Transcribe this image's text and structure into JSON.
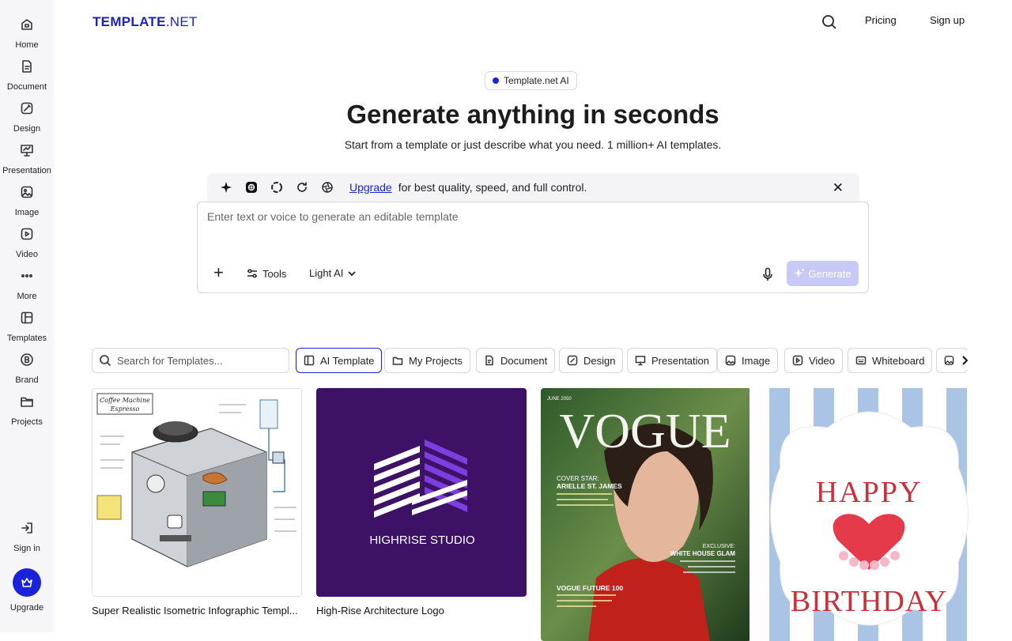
{
  "sidebar": {
    "items": [
      {
        "label": "Home",
        "icon": "home-icon"
      },
      {
        "label": "Document",
        "icon": "document-icon"
      },
      {
        "label": "Design",
        "icon": "design-icon"
      },
      {
        "label": "Presentation",
        "icon": "presentation-icon"
      },
      {
        "label": "Image",
        "icon": "image-icon"
      },
      {
        "label": "Video",
        "icon": "video-icon"
      },
      {
        "label": "More",
        "icon": "more-icon"
      },
      {
        "label": "Templates",
        "icon": "templates-icon"
      },
      {
        "label": "Brand",
        "icon": "brand-icon"
      },
      {
        "label": "Projects",
        "icon": "folder-icon"
      }
    ],
    "signin_label": "Sign in",
    "upgrade_label": "Upgrade"
  },
  "header": {
    "logo_main": "TEMPLATE",
    "logo_suffix": ".NET",
    "pricing_label": "Pricing",
    "signup_label": "Sign up"
  },
  "hero": {
    "badge": "Template.net AI",
    "title": "Generate anything in seconds",
    "subtitle": "Start from a template or just describe what you need. 1 million+ AI templates."
  },
  "upgrade_bar": {
    "link_label": "Upgrade",
    "text": "for best quality, speed, and full control."
  },
  "prompt": {
    "placeholder": "Enter text or voice to generate an editable template",
    "tools_label": "Tools",
    "model_label": "Light AI",
    "generate_label": "Generate"
  },
  "filters": {
    "search_placeholder": "Search for Templates...",
    "chips": [
      "AI Template",
      "My Projects",
      "Document",
      "Design",
      "Presentation",
      "Image",
      "Video",
      "Whiteboard"
    ]
  },
  "cards": [
    {
      "title": "Super Realistic Isometric Infographic Templ...",
      "art_title": "Coffee Machine",
      "art_subtitle": "Espresso"
    },
    {
      "title": "High-Rise Architecture Logo",
      "art_text": "HIGHRISE STUDIO"
    },
    {
      "title": "",
      "masthead": "VOGUE",
      "issue": "JUNE 2050",
      "cover_star_label": "COVER STAR:",
      "cover_star_name": "ARIELLE ST. JAMES",
      "exclusive_label": "EXCLUSIVE:",
      "exclusive_title": "WHITE HOUSE GLAM",
      "future_label": "VOGUE FUTURE 100"
    },
    {
      "title": "",
      "line1": "HAPPY",
      "line2": "BIRTHDAY"
    }
  ],
  "colors": {
    "brand": "#1a23d9",
    "generate_disabled": "#c8c9f7",
    "logo_bg": "#3d1166"
  }
}
